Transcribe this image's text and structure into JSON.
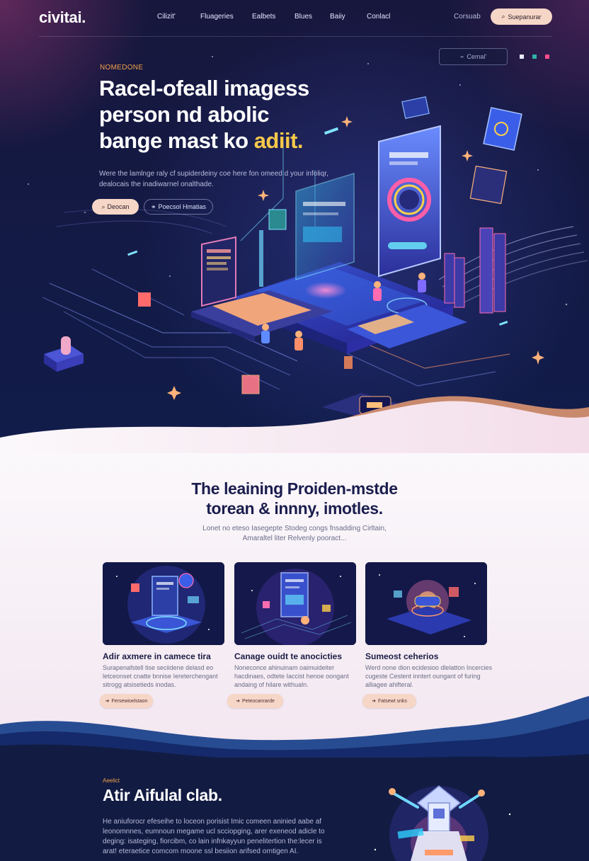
{
  "nav": {
    "logo": "civitai.",
    "links": [
      "Cilizit'",
      "Fluageries",
      "Ealbets",
      "Blues",
      "Baiiy",
      "Conlacl"
    ],
    "right_text": "Corsuab",
    "cta_label": "Suepanurar"
  },
  "hero": {
    "contact_label": "Cemal'",
    "eyebrow": "NOMEDONE",
    "title_lines": [
      "Racel-ofeall imagess",
      "person nd abolic",
      "bange mast ko "
    ],
    "title_highlight": "adiit.",
    "description": "Were the lamlnge raly cf supiderdeiny coe here fon omeed d your infoliqr, dealocais the inadiwarnel onalthade.",
    "primary_button": "Deocan",
    "secondary_button": "Poecsol Hmatias"
  },
  "features": {
    "title_line1": "The leaining Proiden-mstde",
    "title_line2": "torean & innny, imotles.",
    "subtitle": "Lonet no eteso Iasegepte Stodeg congs fnsadding Cirltain, Amaraltel liter Relvenly pooract...",
    "cards": [
      {
        "title": "Adir axmere in camece tira",
        "description": "Surapenafstell tise seciidene delasd eo letceonset cnatte bnnise Iereterchengant sitrogg atsisetieds inodas.",
        "button": "Fersewioelstaon"
      },
      {
        "title": "Canage ouidt te anocicties",
        "description": "Noneconce ahinuinam oaimuideiter hacdinaes, odtete Iaccist henoe oongant andaing of hilare withualn.",
        "button": "Peteocanrarde"
      },
      {
        "title": "Sumeost ceherios",
        "description": "Werd none dion ecidesioo dlelatton Incercies cugeste Cestent inntert oungant of furing alliagee ahifteral.",
        "button": "Fatsewt snks"
      }
    ]
  },
  "bottom": {
    "eyebrow": "Aeelict",
    "title": "Atir Aifulal clab.",
    "description": "He aniuforocr efeseihe to loceon porisist Imic comeen aninied aabe af leonomnnes, eumnoun megame ucl scciopging, arer exeneod adicle to deging: isateging, fiorcibm, co lain infnkayyun penelitertion the:lecer is arat! eteraetice comcom moone ssl besiion arifsed orntigen AI."
  },
  "colors": {
    "navy": "#121b42",
    "peach": "#f6d6c6",
    "accent_orange": "#f0a24a",
    "highlight_yellow": "#f6c94a",
    "heading_dark": "#1b1d4e"
  }
}
